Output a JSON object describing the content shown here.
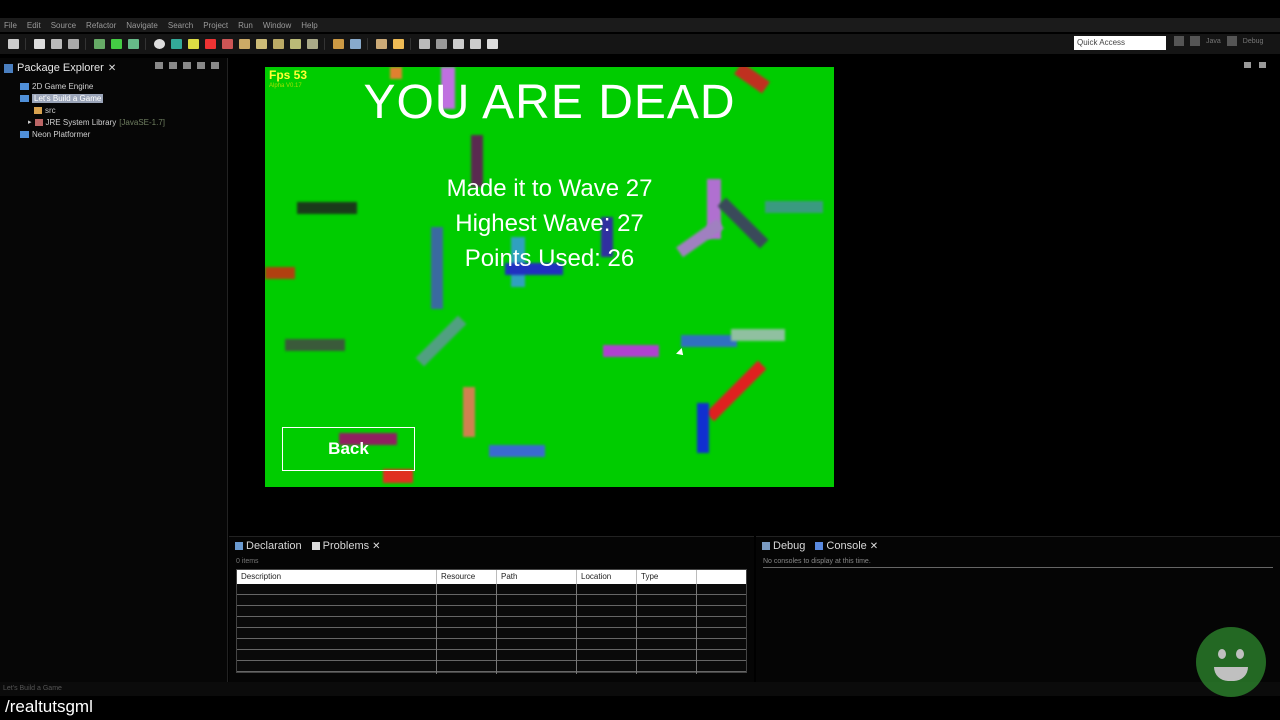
{
  "menu": [
    "File",
    "Edit",
    "Source",
    "Refactor",
    "Navigate",
    "Search",
    "Project",
    "Run",
    "Window",
    "Help"
  ],
  "quick_access": "Quick Access",
  "perspectives": [
    "Java",
    "Debug"
  ],
  "package_explorer": {
    "title": "Package Explorer",
    "items": {
      "engine": "2D Game Engine",
      "game": "Let's Build a Game",
      "src": "src",
      "jre": "JRE System Library",
      "jre_version": "[JavaSE-1.7]",
      "neon": "Neon Platformer"
    }
  },
  "game": {
    "fps": "Fps 53",
    "version": "Alpha V0.17",
    "title": "YOU ARE DEAD",
    "wave_line": "Made it to Wave 27",
    "highest_line": "Highest Wave: 27",
    "points_line": "Points Used: 26",
    "back": "Back",
    "background_color": "#00cc00"
  },
  "bottom_left": {
    "tab_declaration": "Declaration",
    "tab_problems": "Problems",
    "items_count": "0 items",
    "columns": [
      "Description",
      "Resource",
      "Path",
      "Location",
      "Type"
    ]
  },
  "bottom_right": {
    "tab_debug": "Debug",
    "tab_console": "Console",
    "message": "No consoles to display at this time."
  },
  "status": "Let's Build a Game",
  "watermark": "/realtutsgml"
}
